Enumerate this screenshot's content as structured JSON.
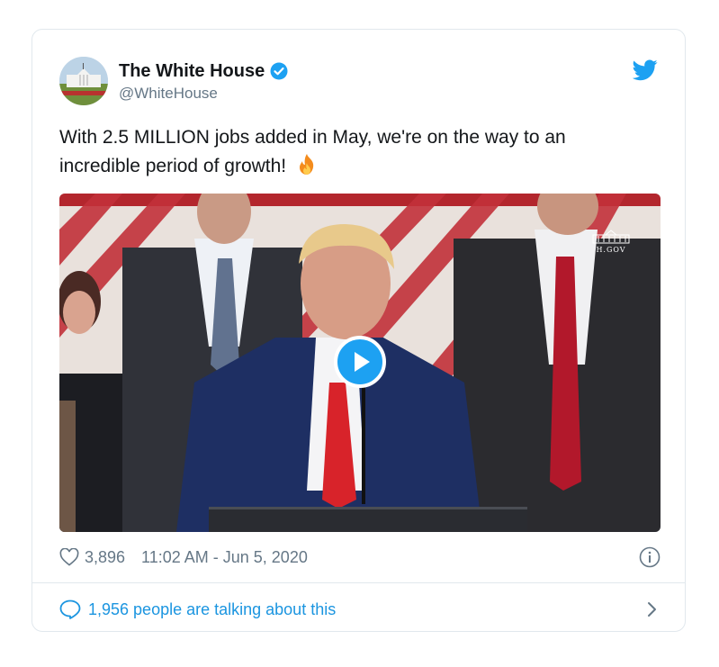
{
  "account": {
    "display_name": "The White House",
    "handle": "@WhiteHouse",
    "verified": true,
    "avatar": "white-house-building-photo"
  },
  "tweet": {
    "text_line1": "With 2.5 MILLION jobs added in May, we're on the way to an",
    "text_line2": "incredible period of growth!",
    "emoji": "fire-emoji"
  },
  "media": {
    "type": "video",
    "thumbnail": "man speaking at podium outdoors with men in suits behind, flag stripes in background",
    "watermark": "H.GOV",
    "play_icon": "play-icon"
  },
  "meta": {
    "likes": "3,896",
    "like_icon": "heart-icon",
    "timestamp": "11:02 AM - Jun 5, 2020",
    "info_icon": "info-icon"
  },
  "conversation": {
    "label": "1,956 people are talking about this",
    "icon": "reply-bubble-icon",
    "chevron": "chevron-right-icon"
  },
  "colors": {
    "twitter_blue": "#1da1f2",
    "link_blue": "#1b95e0",
    "text": "#14171a",
    "muted": "#657786",
    "border": "#e1e8ed"
  }
}
